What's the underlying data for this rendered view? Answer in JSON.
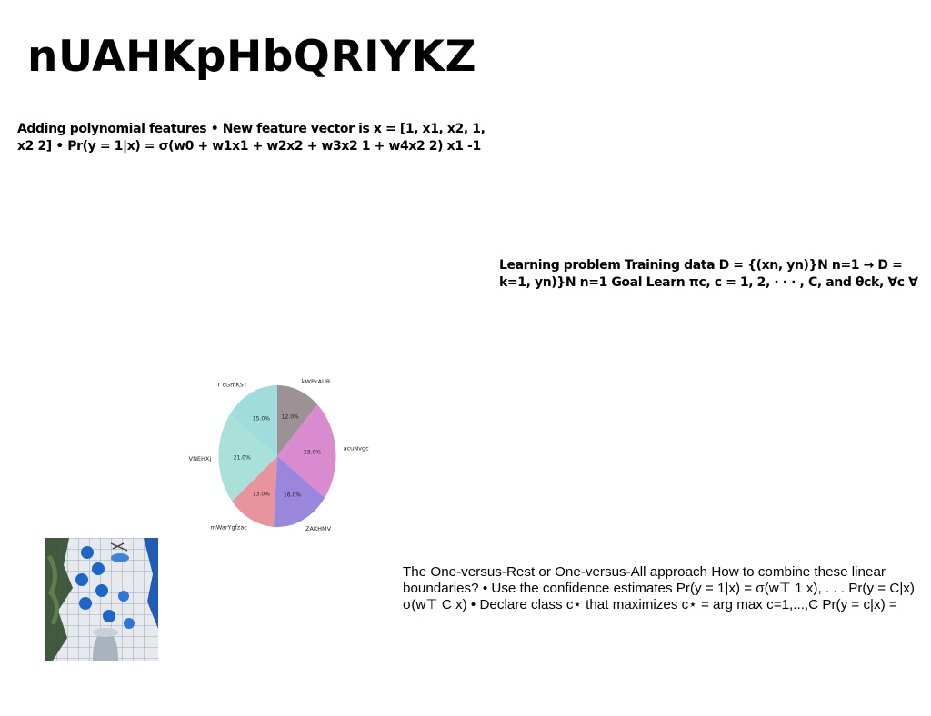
{
  "title": "nUAHKpHbQRIYKZ",
  "text_blocks": {
    "polynomial": "Adding polynomial features • New feature vector is x = [1, x1, x2, 1, x2 2] • Pr(y = 1|x) = σ(w0 + w1x1 + w2x2 + w3x2 1 + w4x2 2) x1 -1",
    "learning_problem": "Learning problem Training data D = {(xn, yn)}N n=1 → D = k=1, yn)}N n=1 Goal Learn πc, c = 1, 2, · · · , C, and θck, ∀c ∀",
    "one_vs_rest": "The One-versus-Rest or One-versus-All approach How to combine these linear boundaries? • Use the confidence estimates Pr(y = 1|x) = σ(w⊤ 1 x), . . . Pr(y = C|x) σ(w⊤ C x) • Declare class c⋆ that maximizes c⋆ = arg max c=1,...,C Pr(y = c|x) ="
  },
  "chart_data": {
    "type": "pie",
    "title": "",
    "start_angle_deg": 90,
    "direction": "clockwise",
    "slices": [
      {
        "label": "kWPkAUR",
        "value": 12.0,
        "display": "12.0%",
        "color": "#9e9196"
      },
      {
        "label": "acuNvgc",
        "value": 23.0,
        "display": "23.0%",
        "color": "#d98bcf"
      },
      {
        "label": "ZAKHMV",
        "value": 16.0,
        "display": "16.0%",
        "color": "#9a86dc"
      },
      {
        "label": "mWarYgfzac",
        "value": 13.0,
        "display": "13.0%",
        "color": "#e8949c"
      },
      {
        "label": "VNEHXj",
        "value": 21.0,
        "display": "21.0%",
        "color": "#a9e0d8"
      },
      {
        "label": "T cGmKST",
        "value": 15.0,
        "display": "15.0%",
        "color": "#a0dcdc"
      }
    ]
  }
}
